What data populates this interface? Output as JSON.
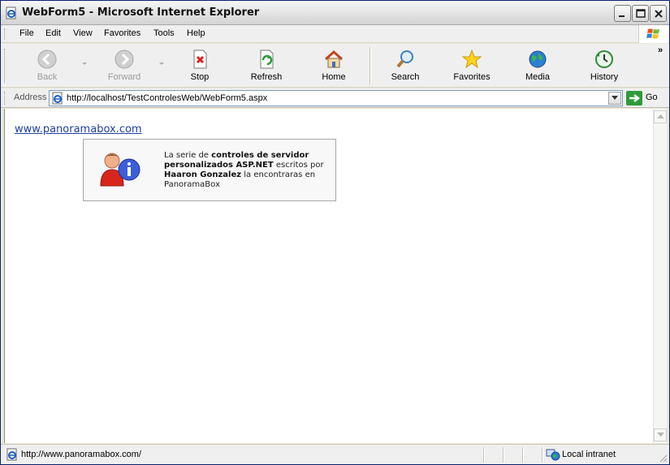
{
  "window": {
    "title": "WebForm5 - Microsoft Internet Explorer",
    "icon": "ie-page-icon"
  },
  "menu": {
    "items": [
      "File",
      "Edit",
      "View",
      "Favorites",
      "Tools",
      "Help"
    ]
  },
  "toolbar": {
    "back_label": "Back",
    "forward_label": "Forward",
    "stop_label": "Stop",
    "refresh_label": "Refresh",
    "home_label": "Home",
    "search_label": "Search",
    "favorites_label": "Favorites",
    "media_label": "Media",
    "history_label": "History",
    "more": "»"
  },
  "address": {
    "label": "Address",
    "url": "http://localhost/TestControlesWeb/WebForm5.aspx",
    "go_label": "Go"
  },
  "page": {
    "link_text": "www.panoramabox.com",
    "info": {
      "t1": "La serie de ",
      "b1": "controles de servidor personalizados ASP.NET",
      "t2": " escritos por ",
      "b2": "Haaron Gonzalez",
      "t3": " la encontraras en PanoramaBox"
    }
  },
  "status": {
    "text": "http://www.panoramabox.com/",
    "zone": "Local intranet"
  },
  "colors": {
    "link": "#1f3fa0",
    "chrome": "#efefef",
    "go_green": "#2e9b3a"
  }
}
